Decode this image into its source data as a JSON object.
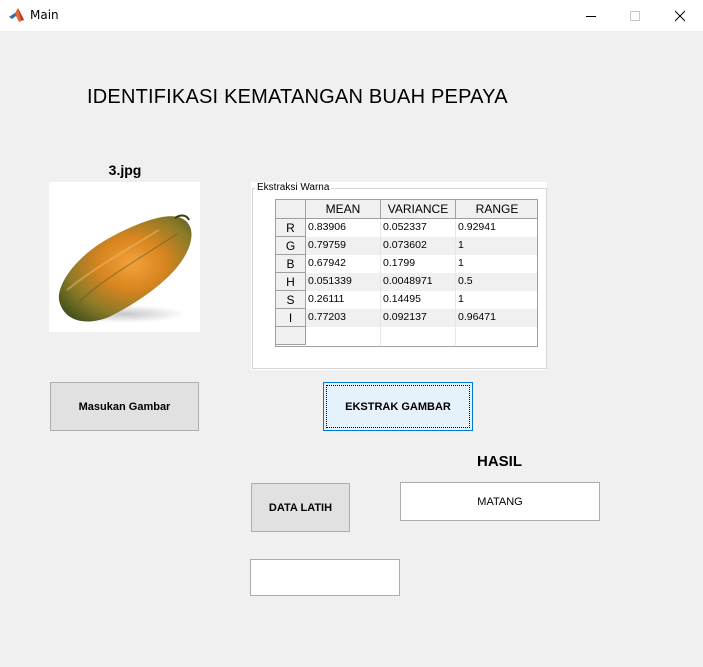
{
  "window": {
    "title": "Main",
    "icon": "matlab-icon",
    "controls": {
      "minimize": "minimize-icon",
      "maximize": "maximize-icon",
      "close": "close-icon"
    }
  },
  "header": {
    "title": "IDENTIFIKASI KEMATANGAN BUAH PEPAYA"
  },
  "image_panel": {
    "filename": "3.jpg",
    "image": "papaya-image"
  },
  "buttons": {
    "masukan": "Masukan Gambar",
    "ekstrak": "EKSTRAK GAMBAR",
    "latih": "DATA LATIH"
  },
  "extraction": {
    "legend": "Ekstraksi Warna",
    "columns": [
      "MEAN",
      "VARIANCE",
      "RANGE"
    ],
    "rows": [
      {
        "label": "R",
        "values": [
          "0.83906",
          "0.052337",
          "0.92941"
        ]
      },
      {
        "label": "G",
        "values": [
          "0.79759",
          "0.073602",
          "1"
        ]
      },
      {
        "label": "B",
        "values": [
          "0.67942",
          "0.1799",
          "1"
        ]
      },
      {
        "label": "H",
        "values": [
          "0.051339",
          "0.0048971",
          "0.5"
        ]
      },
      {
        "label": "S",
        "values": [
          "0.26111",
          "0.14495",
          "1"
        ]
      },
      {
        "label": "I",
        "values": [
          "0.77203",
          "0.092137",
          "0.96471"
        ]
      }
    ]
  },
  "result": {
    "label": "HASIL",
    "value": "MATANG"
  },
  "training": {
    "value": ""
  },
  "colors": {
    "background": "#f0f0f0",
    "focus_button": "#e5f1fb",
    "focus_border": "#0078d7"
  }
}
